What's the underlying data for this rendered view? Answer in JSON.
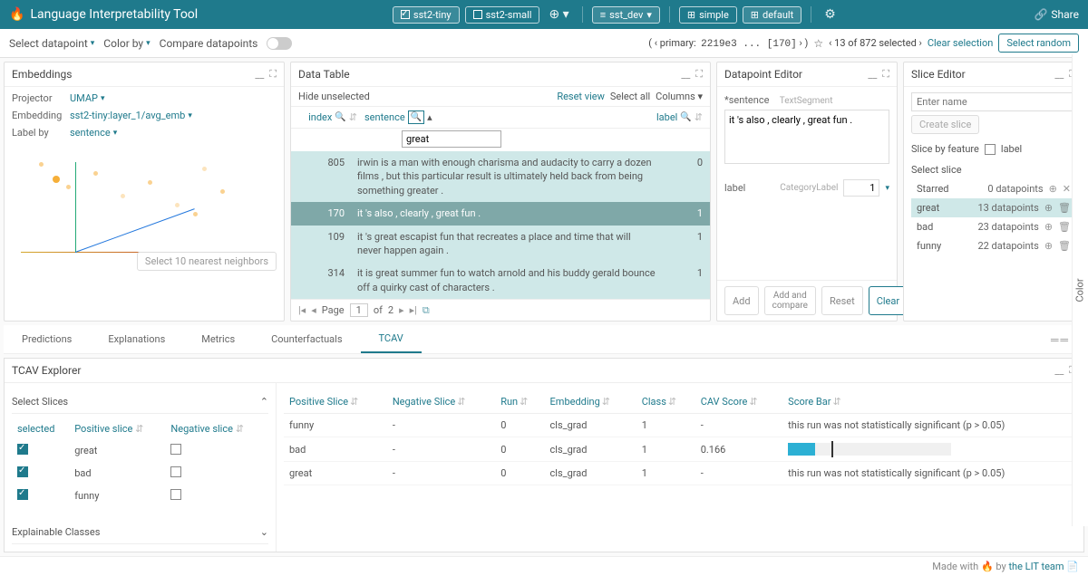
{
  "topbar": {
    "title": "Language Interpretability Tool",
    "models": [
      {
        "name": "sst2-tiny",
        "checked": true
      },
      {
        "name": "sst2-small",
        "checked": false
      }
    ],
    "dataset": "sst_dev",
    "layouts": [
      {
        "name": "simple",
        "active": false
      },
      {
        "name": "default",
        "active": true
      }
    ],
    "share": "Share"
  },
  "subbar": {
    "select_datapoint": "Select datapoint",
    "color_by": "Color by",
    "compare": "Compare datapoints",
    "primary_label": "primary:",
    "primary_value": "2219e3 ... [170]",
    "selection_text": "13 of 872 selected",
    "clear": "Clear selection",
    "random": "Select random"
  },
  "embeddings": {
    "title": "Embeddings",
    "projector_label": "Projector",
    "projector_value": "UMAP",
    "embedding_label": "Embedding",
    "embedding_value": "sst2-tiny:layer_1/avg_emb",
    "labelby_label": "Label by",
    "labelby_value": "sentence",
    "select_nearest": "Select 10 nearest neighbors"
  },
  "datatable": {
    "title": "Data Table",
    "hide_unselected": "Hide unselected",
    "reset_view": "Reset view",
    "select_all": "Select all",
    "columns": "Columns",
    "columns_header": {
      "index": "index",
      "sentence": "sentence",
      "label": "label"
    },
    "search_value": "great",
    "rows": [
      {
        "idx": 805,
        "sentence": "irwin is a man with enough charisma and audacity to carry a dozen films , but this particular result is ultimately held back from being something greater .",
        "label": 0,
        "primary": false
      },
      {
        "idx": 170,
        "sentence": "it 's also , clearly , great fun .",
        "label": 1,
        "primary": true
      },
      {
        "idx": 109,
        "sentence": "it 's great escapist fun that recreates a place and time that will never happen again .",
        "label": 1,
        "primary": false
      },
      {
        "idx": 314,
        "sentence": "it is great summer fun to watch arnold and his buddy gerald bounce off a quirky cast of characters .",
        "label": 1,
        "primary": false
      }
    ],
    "pager": {
      "page_label": "Page",
      "current": 1,
      "of": "of",
      "total": "2"
    }
  },
  "dpeditor": {
    "title": "Datapoint Editor",
    "sentence_field": "*sentence",
    "sentence_type": "TextSegment",
    "sentence_value": "it 's also , clearly , great fun .",
    "label_field": "label",
    "label_type": "CategoryLabel",
    "label_value": "1",
    "add": "Add",
    "addcompare": "Add and compare",
    "reset": "Reset",
    "clear": "Clear"
  },
  "sliceeditor": {
    "title": "Slice Editor",
    "placeholder": "Enter name",
    "create": "Create slice",
    "slice_by_feature": "Slice by feature",
    "feature_label": "label",
    "select_slice": "Select slice",
    "slices": [
      {
        "name": "Starred",
        "count": "0 datapoints",
        "selected": false,
        "trash": false
      },
      {
        "name": "great",
        "count": "13 datapoints",
        "selected": true,
        "trash": true
      },
      {
        "name": "bad",
        "count": "23 datapoints",
        "selected": false,
        "trash": true
      },
      {
        "name": "funny",
        "count": "22 datapoints",
        "selected": false,
        "trash": true
      }
    ]
  },
  "lowertabs": {
    "tabs": [
      "Predictions",
      "Explanations",
      "Metrics",
      "Counterfactuals",
      "TCAV"
    ],
    "active": "TCAV"
  },
  "tcav": {
    "title": "TCAV Explorer",
    "select_slices": "Select Slices",
    "explainable_classes": "Explainable Classes",
    "left_headers": {
      "selected": "selected",
      "pos": "Positive slice",
      "neg": "Negative slice"
    },
    "left_rows": [
      {
        "selected": true,
        "name": "great",
        "neg_checked": false
      },
      {
        "selected": true,
        "name": "bad",
        "neg_checked": false
      },
      {
        "selected": true,
        "name": "funny",
        "neg_checked": false
      }
    ],
    "right_headers": {
      "pos": "Positive Slice",
      "neg": "Negative Slice",
      "run": "Run",
      "embed": "Embedding",
      "class": "Class",
      "cav": "CAV Score",
      "bar": "Score Bar"
    },
    "right_rows": [
      {
        "pos": "funny",
        "neg": "-",
        "run": 0,
        "embed": "cls_grad",
        "class": 1,
        "cav": "-",
        "msg": "this run was not statistically significant (p > 0.05)"
      },
      {
        "pos": "bad",
        "neg": "-",
        "run": 0,
        "embed": "cls_grad",
        "class": 1,
        "cav": "0.166",
        "bar": 0.166
      },
      {
        "pos": "great",
        "neg": "-",
        "run": 0,
        "embed": "cls_grad",
        "class": 1,
        "cav": "-",
        "msg": "this run was not statistically significant (p > 0.05)"
      }
    ]
  },
  "footer": {
    "text_pre": "Made with ",
    "text_post": " by ",
    "team": "the LIT team"
  },
  "color_sidebar": "Color"
}
